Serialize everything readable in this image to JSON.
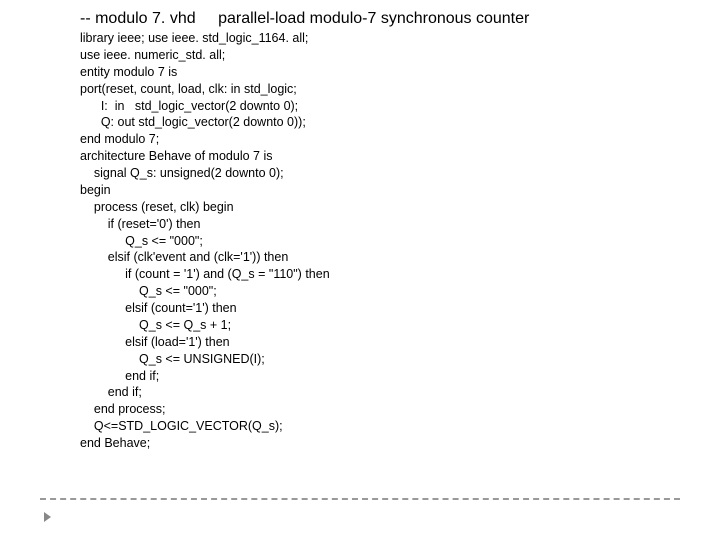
{
  "title": {
    "filename": "-- modulo 7. vhd",
    "description": "parallel-load modulo-7 synchronous counter"
  },
  "code": {
    "l1": "library ieee; use ieee. std_logic_1164. all;",
    "l2": "use ieee. numeric_std. all;",
    "l3": "entity modulo 7 is",
    "l4": "port(reset, count, load, clk: in std_logic;",
    "l5": "      I:  in   std_logic_vector(2 downto 0);",
    "l6": "      Q: out std_logic_vector(2 downto 0));",
    "l7": "end modulo 7;",
    "l8": "architecture Behave of modulo 7 is",
    "l9": "    signal Q_s: unsigned(2 downto 0);",
    "l10": "begin",
    "l11": "    process (reset, clk) begin",
    "l12": "        if (reset='0') then",
    "l13": "             Q_s <= \"000\";",
    "l14": "        elsif (clk'event and (clk='1')) then",
    "l15": "             if (count = '1') and (Q_s = \"110\") then",
    "l16": "                 Q_s <= \"000\";",
    "l17": "             elsif (count='1') then",
    "l18": "                 Q_s <= Q_s + 1;",
    "l19": "             elsif (load='1') then",
    "l20": "                 Q_s <= UNSIGNED(I);",
    "l21": "             end if;",
    "l22": "        end if;",
    "l23": "    end process;",
    "l24": "    Q<=STD_LOGIC_VECTOR(Q_s);",
    "l25": "end Behave;"
  }
}
